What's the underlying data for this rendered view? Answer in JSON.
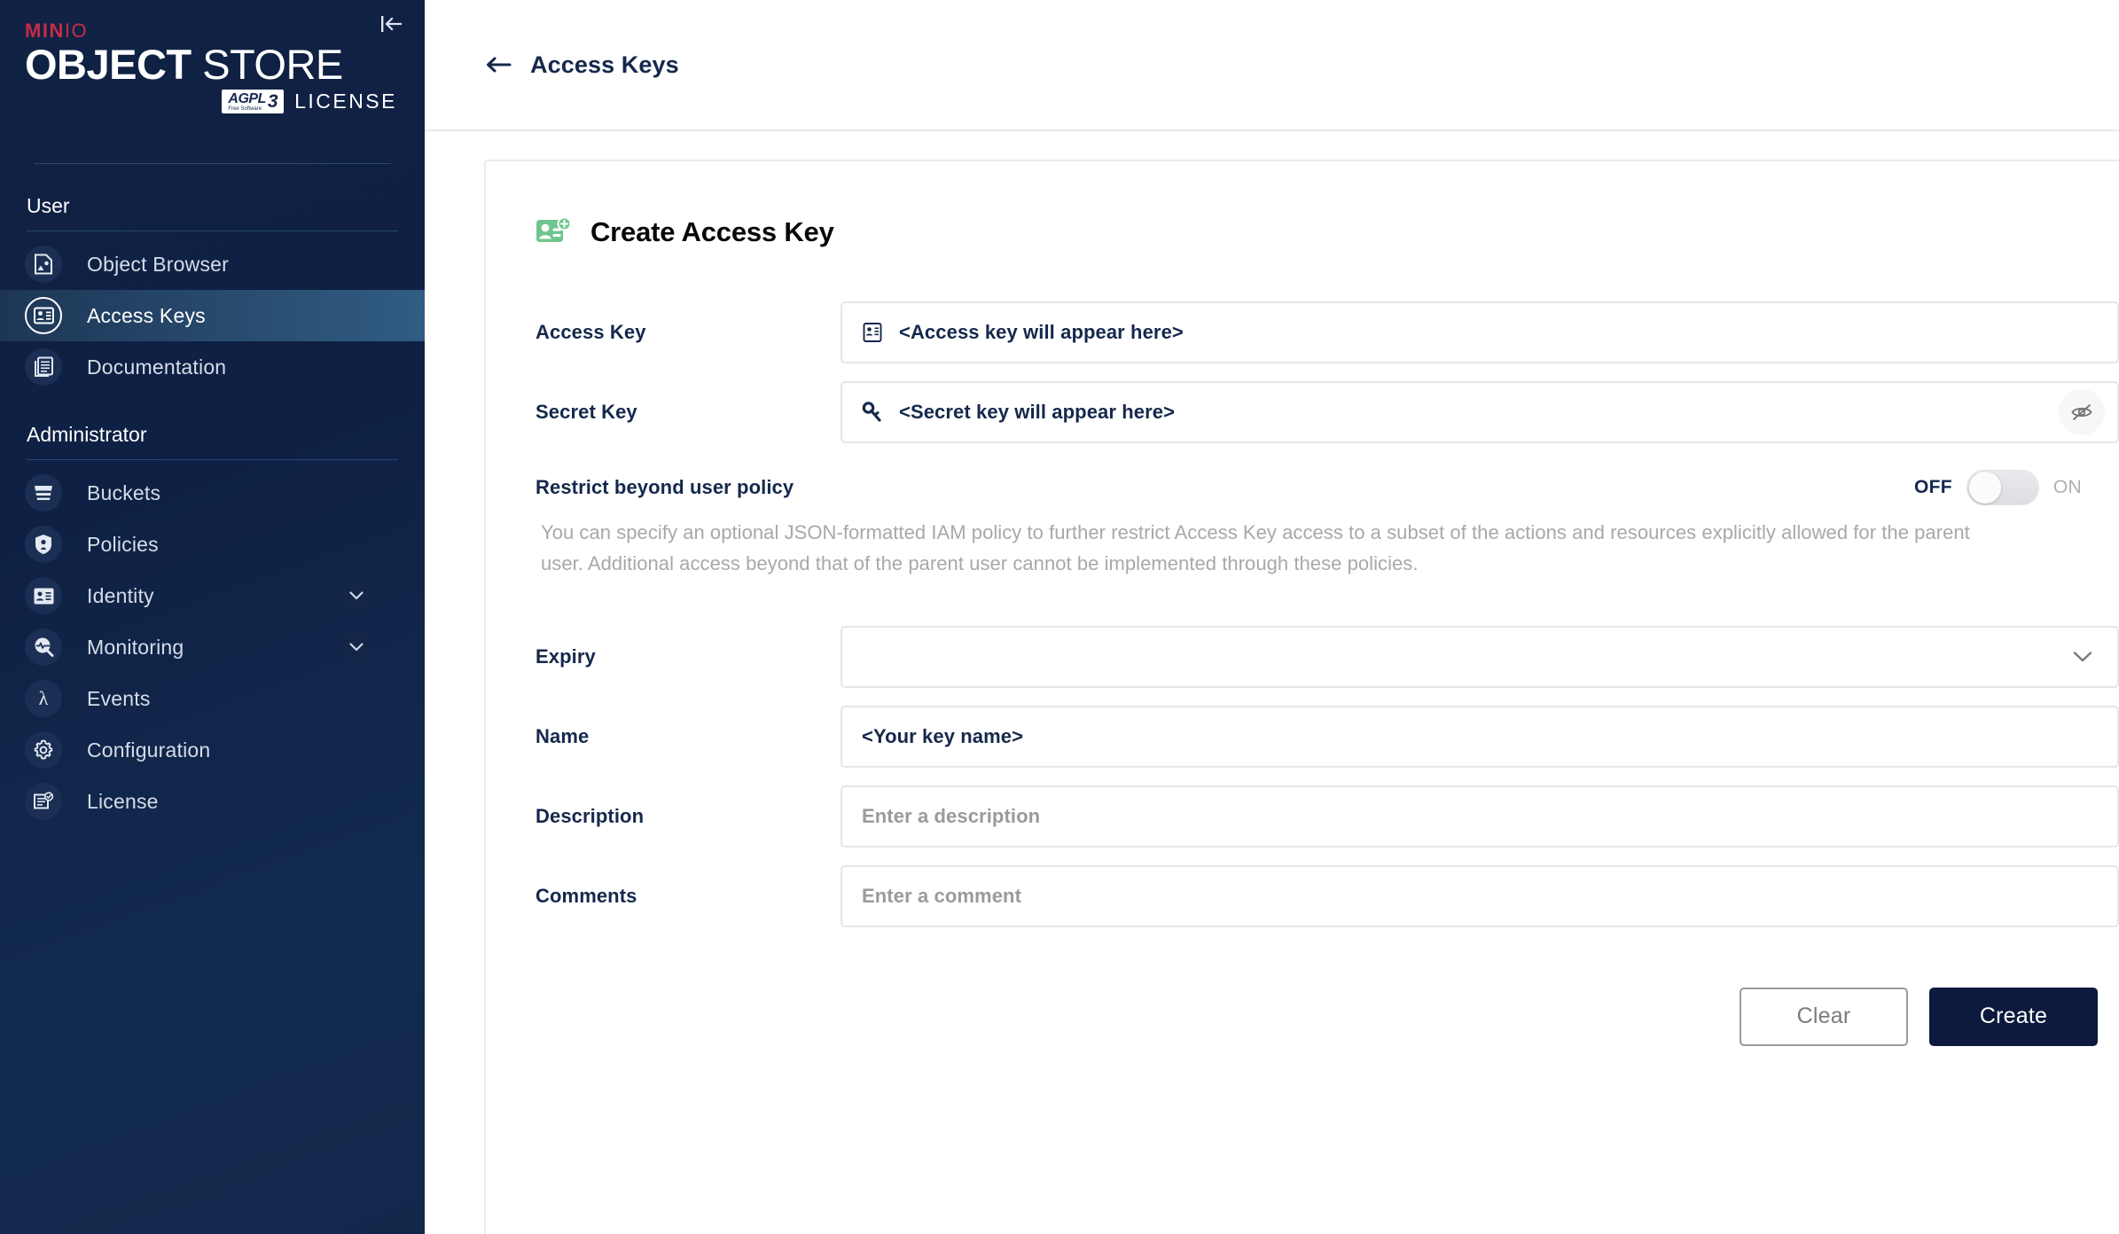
{
  "brand": {
    "min": "MIN",
    "io": "IO",
    "object": "OBJECT",
    "store": " STORE",
    "agpl_main": "AGPL",
    "agpl_sub": "Free Software",
    "agpl_v3": "3",
    "license_word": "LICENSE"
  },
  "sidebar": {
    "collapse_icon": "collapse-sidebar-icon",
    "sections": [
      {
        "title": "User",
        "items": [
          {
            "label": "Object Browser",
            "icon": "object-browser-icon",
            "active": false,
            "expandable": false
          },
          {
            "label": "Access Keys",
            "icon": "access-keys-icon",
            "active": true,
            "expandable": false
          },
          {
            "label": "Documentation",
            "icon": "documentation-icon",
            "active": false,
            "expandable": false
          }
        ]
      },
      {
        "title": "Administrator",
        "items": [
          {
            "label": "Buckets",
            "icon": "bucket-icon",
            "active": false,
            "expandable": false
          },
          {
            "label": "Policies",
            "icon": "shield-lock-icon",
            "active": false,
            "expandable": false
          },
          {
            "label": "Identity",
            "icon": "identity-card-icon",
            "active": false,
            "expandable": true
          },
          {
            "label": "Monitoring",
            "icon": "monitoring-magnifier-icon",
            "active": false,
            "expandable": true
          },
          {
            "label": "Events",
            "icon": "lambda-icon",
            "active": false,
            "expandable": false
          },
          {
            "label": "Configuration",
            "icon": "gear-icon",
            "active": false,
            "expandable": false
          },
          {
            "label": "License",
            "icon": "license-document-icon",
            "active": false,
            "expandable": false
          }
        ]
      }
    ]
  },
  "header": {
    "back_icon": "back-arrow-icon",
    "title": "Access Keys"
  },
  "card": {
    "icon": "create-access-key-icon",
    "title": "Create Access Key",
    "accent_green": "#6FC68C",
    "fields": {
      "access_key": {
        "label": "Access Key",
        "icon": "id-card-icon",
        "value": "<Access key will appear here>"
      },
      "secret_key": {
        "label": "Secret Key",
        "icon": "key-icon",
        "value": "<Secret key will appear here>",
        "visibility_icon": "eye-off-icon"
      },
      "expiry": {
        "label": "Expiry",
        "value": "",
        "chevron_icon": "chevron-down-icon"
      },
      "name": {
        "label": "Name",
        "value": "<Your key name>"
      },
      "description": {
        "label": "Description",
        "placeholder": "Enter a description",
        "value": ""
      },
      "comments": {
        "label": "Comments",
        "placeholder": "Enter a comment",
        "value": ""
      }
    },
    "restrict": {
      "label": "Restrict beyond user policy",
      "off_label": "OFF",
      "on_label": "ON",
      "state": "OFF",
      "description": "You can specify an optional JSON-formatted IAM policy to further restrict Access Key access to a subset of the actions and resources explicitly allowed for the parent user. Additional access beyond that of the parent user cannot be implemented through these policies."
    },
    "actions": {
      "clear_label": "Clear",
      "create_label": "Create"
    }
  },
  "colors": {
    "sidebar_bg": "#112244",
    "sidebar_active": "#2b5175",
    "brand_red": "#C72C48",
    "navy_text": "#15284c",
    "create_button": "#0c1a3d",
    "muted_text": "#a8a8a8"
  }
}
